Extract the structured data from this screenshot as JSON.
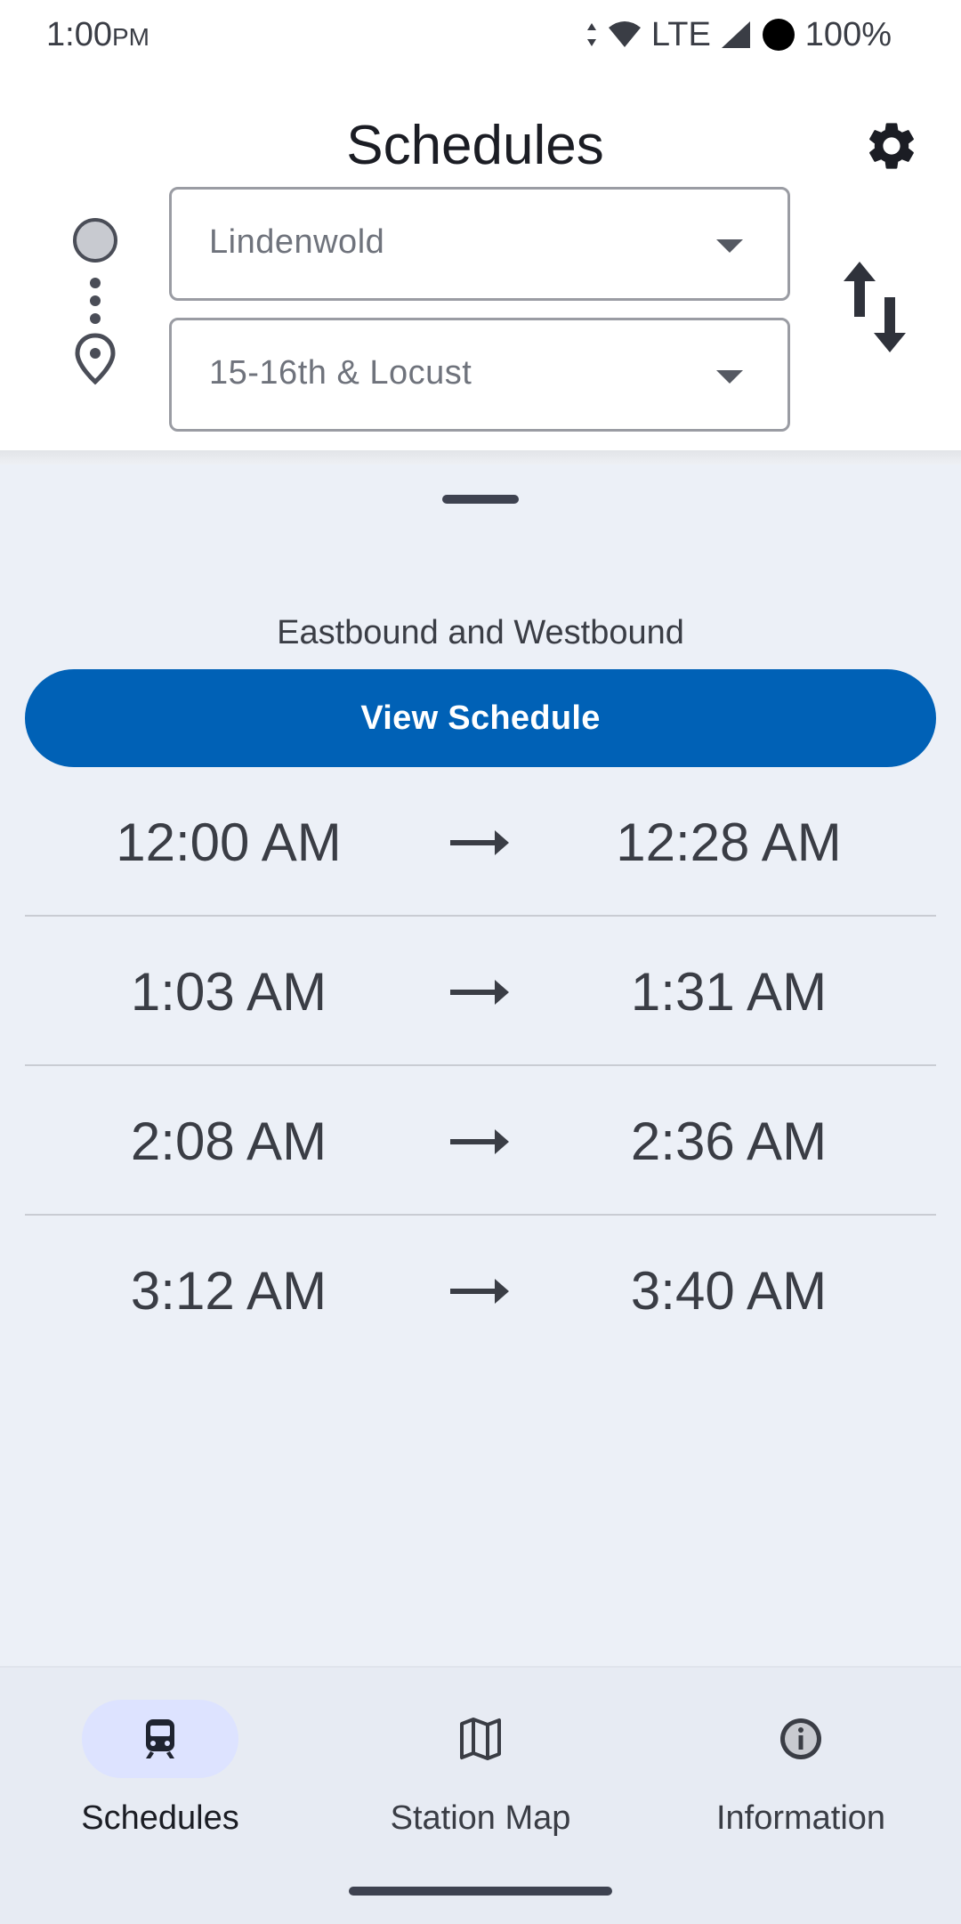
{
  "status_bar": {
    "time": "1:00",
    "ampm": "PM",
    "network": "LTE",
    "battery": "100%",
    "icons": [
      "data-arrows-icon",
      "wifi-icon",
      "signal-icon",
      "battery-icon"
    ]
  },
  "header": {
    "title": "Schedules",
    "settings_icon": "gear-icon",
    "origin": {
      "value": "Lindenwold",
      "icon": "circle-icon"
    },
    "destination": {
      "value": "15-16th & Locust",
      "icon": "location-pin-icon"
    },
    "swap_icon": "swap-vertical-icon"
  },
  "sheet": {
    "direction_label": "Eastbound and Westbound",
    "view_button_label": "View Schedule",
    "trips": [
      {
        "depart": "12:00 AM",
        "arrive": "12:28 AM"
      },
      {
        "depart": "1:03 AM",
        "arrive": "1:31 AM"
      },
      {
        "depart": "2:08 AM",
        "arrive": "2:36 AM"
      },
      {
        "depart": "3:12 AM",
        "arrive": "3:40 AM"
      }
    ]
  },
  "bottom_nav": {
    "items": [
      {
        "label": "Schedules",
        "icon": "train-icon",
        "active": true
      },
      {
        "label": "Station Map",
        "icon": "map-icon",
        "active": false
      },
      {
        "label": "Information",
        "icon": "info-icon",
        "active": false
      }
    ]
  },
  "colors": {
    "primary_button": "#0061b6",
    "sheet_background": "#ecf0f7",
    "nav_active_pill": "#dde3ff"
  }
}
